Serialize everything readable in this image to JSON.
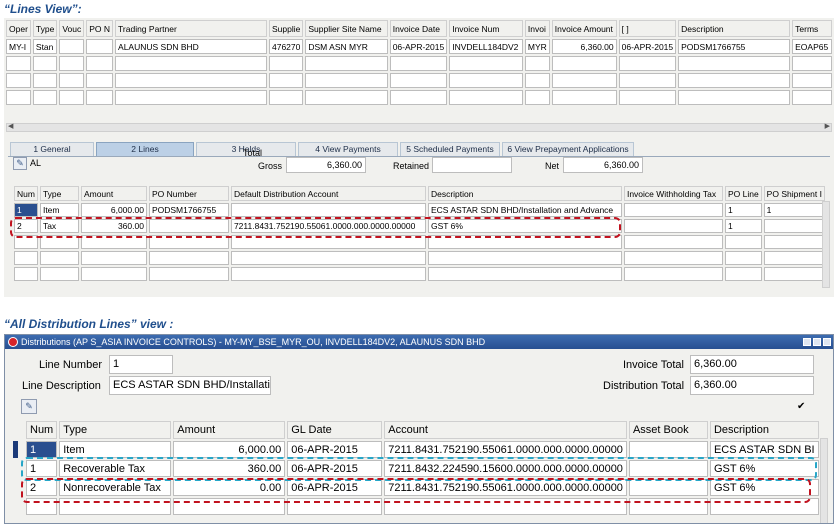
{
  "captions": {
    "lines_view": "“Lines View”:",
    "distribution_view": "“All Distribution Lines” view :"
  },
  "lines_view": {
    "columns": [
      "Oper",
      "Type",
      "Vouc",
      "PO N",
      "Trading Partner",
      "Supplie",
      "Supplier Site Name",
      "Invoice Date",
      "Invoice Num",
      "Invoi",
      "Invoice Amount",
      "[ ]",
      "Description",
      "Terms"
    ],
    "rows": [
      [
        "MY-I",
        "Stan",
        "",
        "",
        "ALAUNUS SDN BHD",
        "476270",
        "DSM ASN MYR",
        "06-APR-2015",
        "INVDELL184DV2",
        "MYR",
        "6,360.00",
        "06-APR-2015",
        "PODSM1766755",
        "EOAP65"
      ]
    ],
    "tabs": [
      "1 General",
      "2 Lines",
      "3 Holds",
      "4 View Payments",
      "5 Scheduled Payments",
      "6 View Prepayment Applications"
    ],
    "active_tab": "2 Lines",
    "al_label": "AL",
    "total_label": "Total",
    "gross_label": "Gross",
    "gross_value": "6,360.00",
    "retained_label": "Retained",
    "retained_value": "",
    "net_label": "Net",
    "net_value": "6,360.00",
    "line_columns": [
      "Num",
      "Type",
      "Amount",
      "PO Number",
      "Default Distribution Account",
      "Description",
      "Invoice Withholding Tax",
      "PO Line",
      "PO Shipment I"
    ],
    "line_rows": [
      [
        "1",
        "Item",
        "6,000.00",
        "PODSM1766755",
        "",
        "ECS ASTAR SDN BHD/Installation and Advance",
        "",
        "1",
        "1"
      ],
      [
        "2",
        "Tax",
        "360.00",
        "",
        "7211.8431.752190.55061.0000.000.0000.00000",
        "GST 6%",
        "",
        "1",
        ""
      ]
    ]
  },
  "distributions": {
    "title": "Distributions (AP S_ASIA INVOICE CONTROLS) - MY-MY_BSE_MYR_OU, INVDELL184DV2, ALAUNUS SDN BHD",
    "line_number_label": "Line Number",
    "line_number_value": "1",
    "line_description_label": "Line Description",
    "line_description_value": "ECS ASTAR SDN BHD/Installati",
    "invoice_total_label": "Invoice Total",
    "invoice_total_value": "6,360.00",
    "distribution_total_label": "Distribution Total",
    "distribution_total_value": "6,360.00",
    "check_mark": "✔",
    "columns": [
      "Num",
      "Type",
      "Amount",
      "GL Date",
      "Account",
      "Asset Book",
      "Description"
    ],
    "rows": [
      [
        "1",
        "Item",
        "6,000.00",
        "06-APR-2015",
        "7211.8431.752190.55061.0000.000.0000.00000",
        "",
        "ECS ASTAR SDN BI"
      ],
      [
        "1",
        "Recoverable Tax",
        "360.00",
        "06-APR-2015",
        "7211.8432.224590.15600.0000.000.0000.00000",
        "",
        "GST 6%"
      ],
      [
        "2",
        "Nonrecoverable Tax",
        "0.00",
        "06-APR-2015",
        "7211.8431.752190.55061.0000.000.0000.00000",
        "",
        "GST 6%"
      ]
    ]
  },
  "colors": {
    "highlight_red": "#c1121f",
    "highlight_blue": "#27a6c8",
    "title_bar": "#274f91",
    "selected_cell": "#2a4f8f"
  }
}
